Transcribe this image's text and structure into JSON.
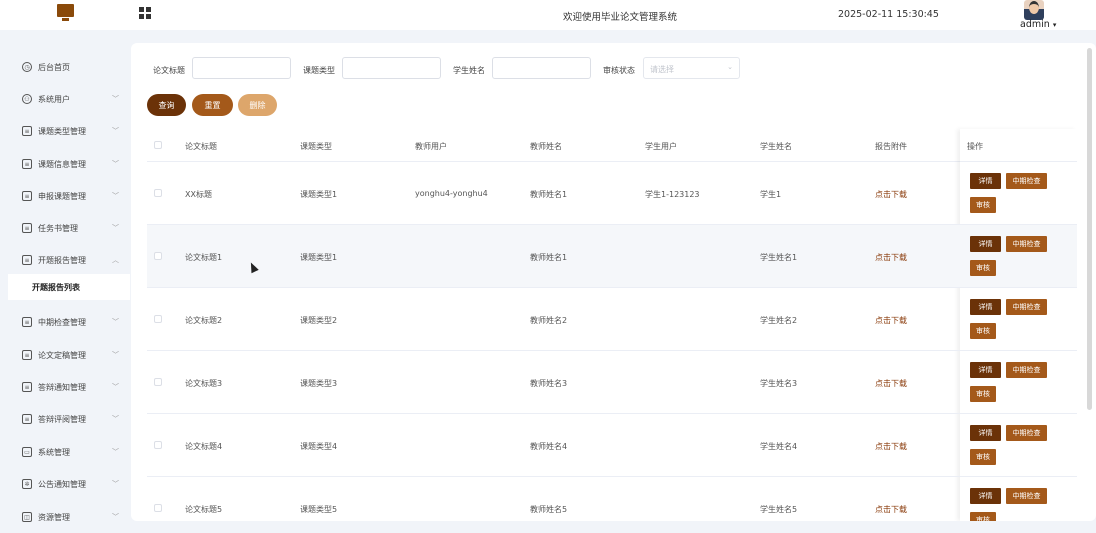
{
  "header": {
    "title": "欢迎使用毕业论文管理系统",
    "datetime": "2025-02-11 15:30:45",
    "user": "admin",
    "brand_color": "#8a4a0a"
  },
  "sidebar": {
    "items": [
      {
        "label": "后台首页",
        "icon": "clock-icon",
        "expanded": false,
        "has_children": false
      },
      {
        "label": "系统用户",
        "icon": "user-icon",
        "expanded": false,
        "has_children": true
      },
      {
        "label": "课题类型管理",
        "icon": "list-icon",
        "expanded": false,
        "has_children": true
      },
      {
        "label": "课题信息管理",
        "icon": "list-icon",
        "expanded": false,
        "has_children": true
      },
      {
        "label": "申报课题管理",
        "icon": "list-icon",
        "expanded": false,
        "has_children": true
      },
      {
        "label": "任务书管理",
        "icon": "list-icon",
        "expanded": false,
        "has_children": true
      },
      {
        "label": "开题报告管理",
        "icon": "list-icon",
        "expanded": true,
        "has_children": true
      },
      {
        "label": "中期检查管理",
        "icon": "list-icon",
        "expanded": false,
        "has_children": true
      },
      {
        "label": "论文定稿管理",
        "icon": "list-icon",
        "expanded": false,
        "has_children": true
      },
      {
        "label": "答辩通知管理",
        "icon": "list-icon",
        "expanded": false,
        "has_children": true
      },
      {
        "label": "答辩评阅管理",
        "icon": "list-icon",
        "expanded": false,
        "has_children": true
      },
      {
        "label": "系统管理",
        "icon": "folder-icon",
        "expanded": false,
        "has_children": true
      },
      {
        "label": "公告通知管理",
        "icon": "bell-icon",
        "expanded": false,
        "has_children": true
      },
      {
        "label": "资源管理",
        "icon": "box-icon",
        "expanded": false,
        "has_children": true
      }
    ],
    "active_submenu": "开题报告列表"
  },
  "filters": {
    "thesis_title_label": "论文标题",
    "topic_type_label": "课题类型",
    "student_name_label": "学生姓名",
    "audit_status_label": "审核状态",
    "audit_status_placeholder": "请选择"
  },
  "actions": {
    "query": "查询",
    "reset": "重置",
    "delete": "删除"
  },
  "table": {
    "columns": [
      "论文标题",
      "课题类型",
      "教师用户",
      "教师姓名",
      "学生用户",
      "学生姓名",
      "报告附件",
      "操作"
    ],
    "rows": [
      {
        "title": "XX标题",
        "type": "课题类型1",
        "teacher_user": "yonghu4-yonghu4",
        "teacher_name": "教师姓名1",
        "student_user": "学生1-123123",
        "student_name": "学生1",
        "attachment": "点击下载"
      },
      {
        "title": "论文标题1",
        "type": "课题类型1",
        "teacher_user": "",
        "teacher_name": "教师姓名1",
        "student_user": "",
        "student_name": "学生姓名1",
        "attachment": "点击下载"
      },
      {
        "title": "论文标题2",
        "type": "课题类型2",
        "teacher_user": "",
        "teacher_name": "教师姓名2",
        "student_user": "",
        "student_name": "学生姓名2",
        "attachment": "点击下载"
      },
      {
        "title": "论文标题3",
        "type": "课题类型3",
        "teacher_user": "",
        "teacher_name": "教师姓名3",
        "student_user": "",
        "student_name": "学生姓名3",
        "attachment": "点击下载"
      },
      {
        "title": "论文标题4",
        "type": "课题类型4",
        "teacher_user": "",
        "teacher_name": "教师姓名4",
        "student_user": "",
        "student_name": "学生姓名4",
        "attachment": "点击下载"
      },
      {
        "title": "论文标题5",
        "type": "课题类型5",
        "teacher_user": "",
        "teacher_name": "教师姓名5",
        "student_user": "",
        "student_name": "学生姓名5",
        "attachment": "点击下载"
      }
    ],
    "row_actions": {
      "detail": "详情",
      "midterm": "中期检查",
      "audit": "审核"
    }
  }
}
